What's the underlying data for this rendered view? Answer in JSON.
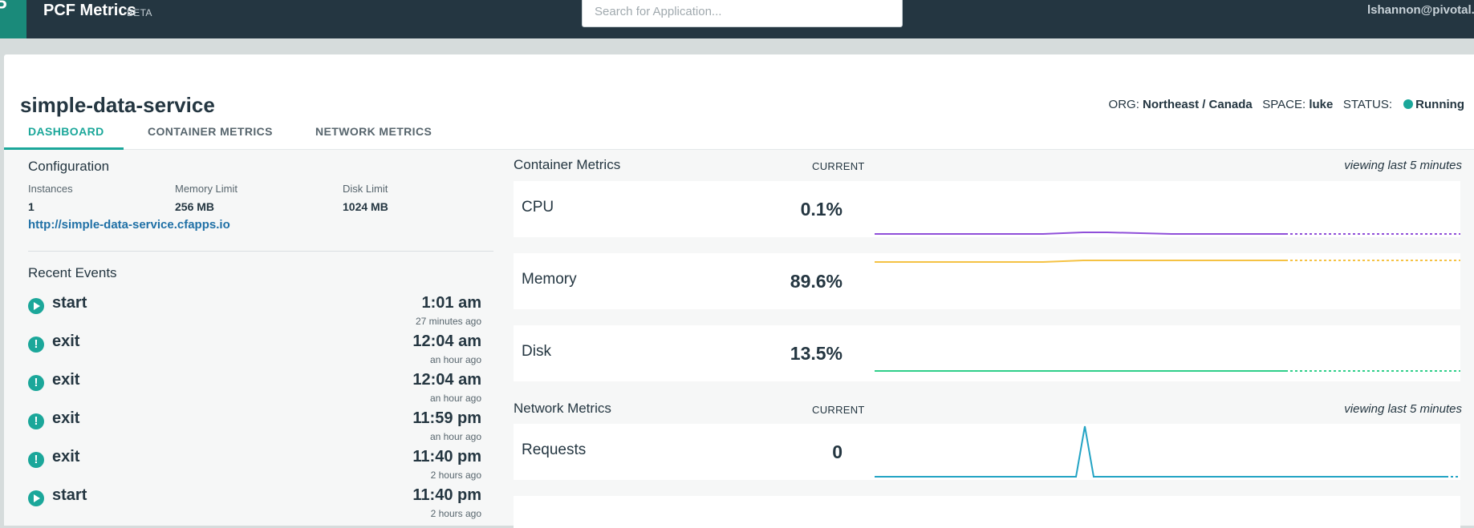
{
  "topbar": {
    "logo_letter": "P",
    "title": "PCF Metrics",
    "badge": "BETA",
    "search_placeholder": "Search for Application...",
    "user": "lshannon@pivotal."
  },
  "app": {
    "name": "simple-data-service",
    "org_label": "ORG:",
    "org_value": "Northeast / Canada",
    "space_label": "SPACE:",
    "space_value": "luke",
    "status_label": "STATUS:",
    "status_value": "Running"
  },
  "tabs": [
    {
      "label": "DASHBOARD",
      "active": true
    },
    {
      "label": "CONTAINER METRICS",
      "active": false
    },
    {
      "label": "NETWORK METRICS",
      "active": false
    }
  ],
  "config": {
    "title": "Configuration",
    "instances_label": "Instances",
    "instances_value": "1",
    "memory_label": "Memory Limit",
    "memory_value": "256 MB",
    "disk_label": "Disk Limit",
    "disk_value": "1024 MB",
    "url": "http://simple-data-service.cfapps.io"
  },
  "events": {
    "title": "Recent Events",
    "items": [
      {
        "type": "start",
        "icon": "play-circle-icon",
        "name": "start",
        "time": "1:01 am",
        "ago": "27 minutes ago"
      },
      {
        "type": "exit",
        "icon": "alert-circle-icon",
        "name": "exit",
        "time": "12:04 am",
        "ago": "an hour ago"
      },
      {
        "type": "exit",
        "icon": "alert-circle-icon",
        "name": "exit",
        "time": "12:04 am",
        "ago": "an hour ago"
      },
      {
        "type": "exit",
        "icon": "alert-circle-icon",
        "name": "exit",
        "time": "11:59 pm",
        "ago": "an hour ago"
      },
      {
        "type": "exit",
        "icon": "alert-circle-icon",
        "name": "exit",
        "time": "11:40 pm",
        "ago": "2 hours ago"
      },
      {
        "type": "start",
        "icon": "play-circle-icon",
        "name": "start",
        "time": "11:40 pm",
        "ago": "2 hours ago"
      }
    ]
  },
  "container_metrics": {
    "title": "Container Metrics",
    "current_label": "CURRENT",
    "viewing": "viewing last 5 minutes",
    "rows": [
      {
        "name": "CPU",
        "value": "0.1%",
        "color": "#8f4fd9"
      },
      {
        "name": "Memory",
        "value": "89.6%",
        "color": "#f5c243"
      },
      {
        "name": "Disk",
        "value": "13.5%",
        "color": "#2fcf8a"
      }
    ]
  },
  "network_metrics": {
    "title": "Network Metrics",
    "current_label": "CURRENT",
    "viewing": "viewing last 5 minutes",
    "rows": [
      {
        "name": "Requests",
        "value": "0",
        "color": "#22a3c4"
      }
    ]
  },
  "colors": {
    "topbar": "#243641",
    "accent": "#1ba79a",
    "link": "#1f70a6"
  }
}
